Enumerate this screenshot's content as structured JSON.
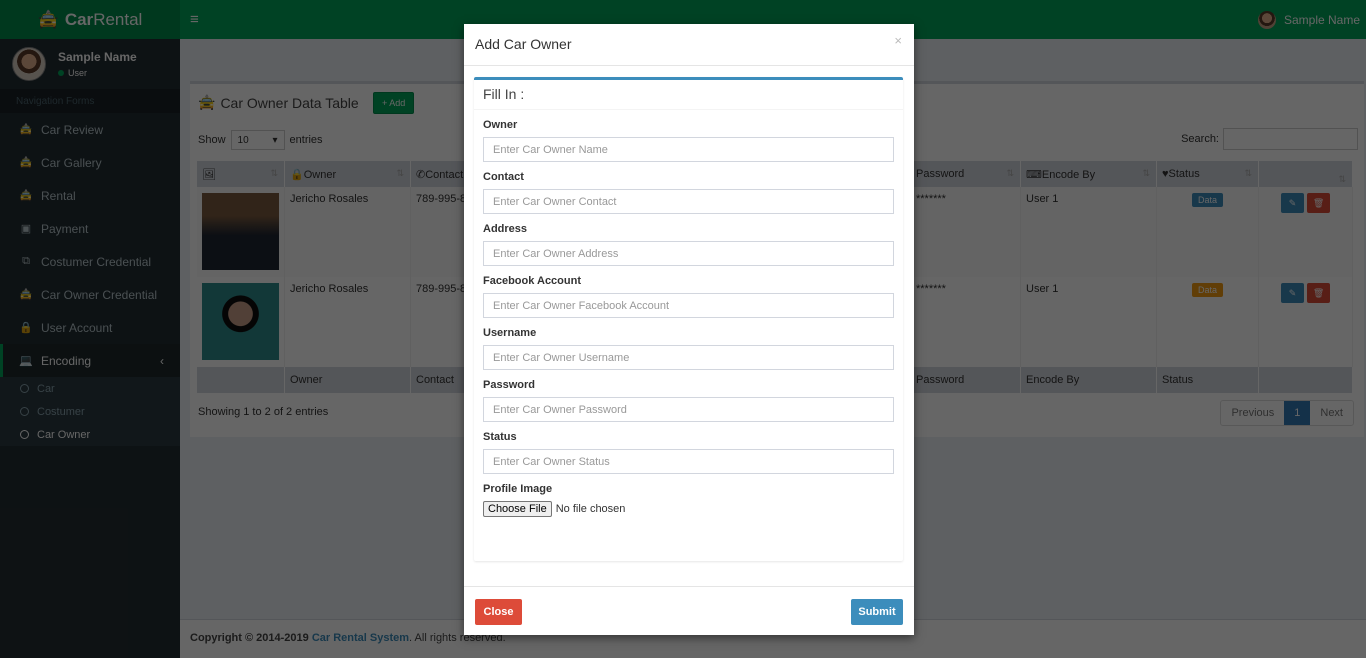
{
  "header": {
    "logo_bold": "Car",
    "logo_rest": "Rental",
    "menu_icon": "≡",
    "user_name": "Sample Name"
  },
  "sidebar": {
    "user_name": "Sample Name",
    "user_status": "User",
    "nav_heading": "Navigation Forms",
    "items": [
      {
        "label": "Car Review",
        "icon": "car-icon"
      },
      {
        "label": "Car Gallery",
        "icon": "car-icon"
      },
      {
        "label": "Rental",
        "icon": "car-icon"
      },
      {
        "label": "Payment",
        "icon": "money-icon"
      },
      {
        "label": "Costumer Credential",
        "icon": "copy-icon"
      },
      {
        "label": "Car Owner Credential",
        "icon": "car-icon"
      },
      {
        "label": "User Account",
        "icon": "lock-icon"
      },
      {
        "label": "Encoding",
        "icon": "laptop-icon",
        "active": true
      }
    ],
    "subitems": [
      {
        "label": "Car"
      },
      {
        "label": "Costumer"
      },
      {
        "label": "Car Owner",
        "active": true
      }
    ]
  },
  "main": {
    "title": "Car Owner Data Table",
    "add_label": "+ Add",
    "show_label": "Show",
    "entries_value": "10",
    "entries_label": "entries",
    "search_label": "Search:",
    "columns": [
      "",
      "Owner",
      "Contact",
      "Password",
      "Encode By",
      "Status",
      ""
    ],
    "footer_columns": [
      "",
      "Owner",
      "Contact",
      "Password",
      "Encode By",
      "Status",
      ""
    ],
    "rows": [
      {
        "owner": "Jericho Rosales",
        "contact": "789-995-8",
        "password": "*******",
        "encode_by": "User 1",
        "status": "Data",
        "status_color": "#3c8dbc"
      },
      {
        "owner": "Jericho Rosales",
        "contact": "789-995-8",
        "password": "*******",
        "encode_by": "User 1",
        "status": "Data",
        "status_color": "#f39c12"
      }
    ],
    "info": "Showing 1 to 2 of 2 entries",
    "pager": {
      "prev": "Previous",
      "current": "1",
      "next": "Next"
    }
  },
  "footer": {
    "prefix": "Copyright © 2014-2019 ",
    "link": "Car Rental System",
    "suffix": ". All rights reserved."
  },
  "modal": {
    "title": "Add Car Owner",
    "close_x": "×",
    "panel_title": "Fill In :",
    "fields": [
      {
        "label": "Owner",
        "placeholder": "Enter Car Owner Name"
      },
      {
        "label": "Contact",
        "placeholder": "Enter Car Owner Contact"
      },
      {
        "label": "Address",
        "placeholder": "Enter Car Owner Address"
      },
      {
        "label": "Facebook Account",
        "placeholder": "Enter Car Owner Facebook Account"
      },
      {
        "label": "Username",
        "placeholder": "Enter Car Owner Username"
      },
      {
        "label": "Password",
        "placeholder": "Enter Car Owner Password"
      },
      {
        "label": "Status",
        "placeholder": "Enter Car Owner Status"
      }
    ],
    "file_label": "Profile Image",
    "file_button": "Choose File",
    "file_status": "No file chosen",
    "close_button": "Close",
    "submit_button": "Submit"
  }
}
